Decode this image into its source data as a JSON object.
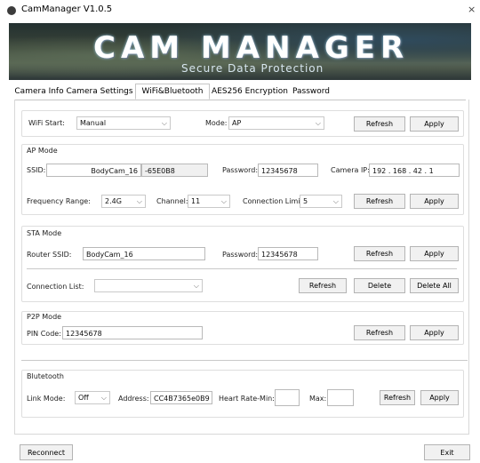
{
  "window": {
    "title": "CamManager V1.0.5",
    "close_label": "×"
  },
  "banner": {
    "title": "CAM MANAGER",
    "subtitle": "Secure Data Protection"
  },
  "tabs": [
    {
      "label": "Camera Info"
    },
    {
      "label": "Camera Settings"
    },
    {
      "label": "WiFi&Bluetooth",
      "active": true
    },
    {
      "label": "AES256 Encryption"
    },
    {
      "label": "Password"
    }
  ],
  "wifi": {
    "start_label": "WiFi Start:",
    "start_value": "Manual",
    "mode_label": "Mode:",
    "mode_value": "AP",
    "refresh": "Refresh",
    "apply": "Apply"
  },
  "ap": {
    "title": "AP Mode",
    "ssid_label": "SSID:",
    "ssid_value": "BodyCam_16",
    "ssid_suffix": "-65E0B8",
    "password_label": "Password:",
    "password_value": "12345678",
    "camera_ip_label": "Camera IP:",
    "camera_ip_value": "192 . 168 . 42 . 1",
    "freq_label": "Frequency Range:",
    "freq_value": "2.4G",
    "channel_label": "Channel:",
    "channel_value": "11",
    "conn_limit_label": "Connection Limit:",
    "conn_limit_value": "5",
    "refresh_top": "Refresh",
    "apply_top": "Apply",
    "refresh": "Refresh",
    "apply": "Apply"
  },
  "sta": {
    "title": "STA Mode",
    "router_label": "Router SSID:",
    "router_value": "BodyCam_16",
    "password_label": "Password:",
    "password_value": "12345678",
    "refresh": "Refresh",
    "apply": "Apply",
    "conn_list_label": "Connection List:",
    "conn_list_value": "",
    "refresh2": "Refresh",
    "delete": "Delete",
    "delete_all": "Delete All"
  },
  "p2p": {
    "title": "P2P Mode",
    "pin_label": "PIN Code:",
    "pin_value": "12345678",
    "refresh": "Refresh",
    "apply": "Apply"
  },
  "bluetooth": {
    "title": "Blutetooth",
    "link_label": "Link Mode:",
    "link_value": "Off",
    "address_label": "Address:",
    "address_value": "CC4B7365e0B9",
    "hr_min_label": "Heart Rate-Min:",
    "hr_min_value": "",
    "max_label": "Max:",
    "max_value": "",
    "refresh": "Refresh",
    "apply": "Apply"
  },
  "footer": {
    "reconnect": "Reconnect",
    "exit": "Exit"
  },
  "icons": {
    "dropdown": "chevron-down-icon",
    "app": "app-icon"
  }
}
